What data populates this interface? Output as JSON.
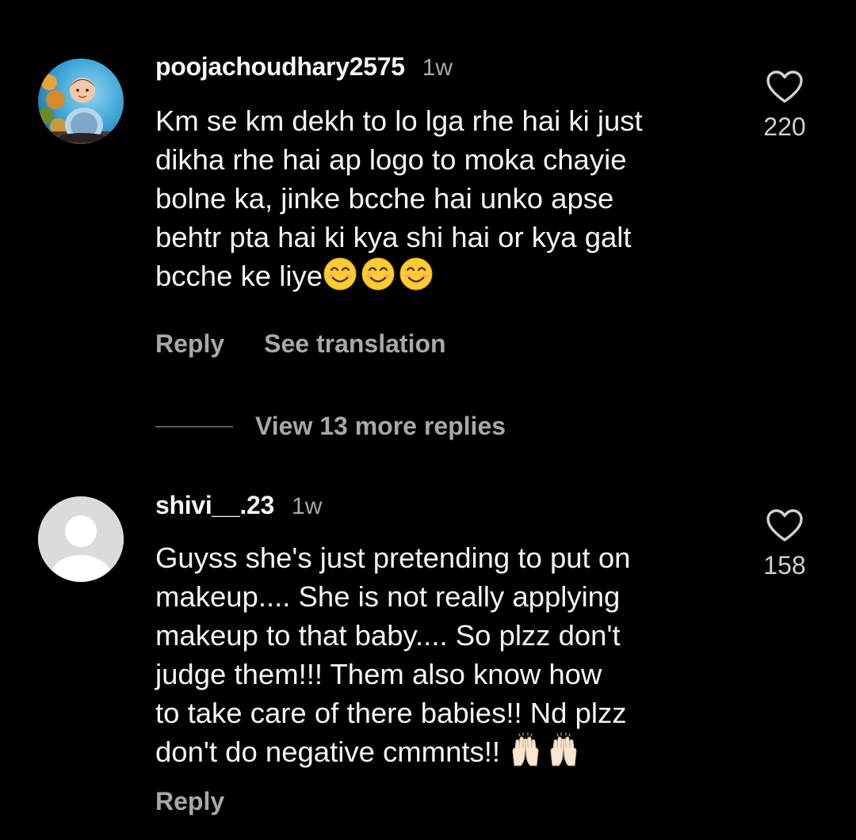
{
  "comments": [
    {
      "username": "poojachoudhary2575",
      "time": "1w",
      "text_lines": [
        "Km se km dekh to lo lga rhe hai ki just",
        "dikha rhe hai ap logo to moka chayie",
        "bolne ka, jinke bcche hai unko apse",
        "behtr pta hai ki kya shi hai or kya galt",
        "bcche ke liye"
      ],
      "trailing_emoji": [
        "smiling-face-emoji",
        "smiling-face-emoji",
        "smiling-face-emoji"
      ],
      "likes": "220",
      "reply_label": "Reply",
      "translate_label": "See translation",
      "view_replies_label": "View 13 more replies",
      "avatar": "profile-photo-child"
    },
    {
      "username": "shivi__.23",
      "time": "1w",
      "text_lines": [
        "Guyss she's just pretending to put on",
        "makeup.... She is not really applying",
        "makeup to that baby.... So plzz don't",
        "judge them!!! Them also know how",
        "to take care of there babies!! Nd plzz",
        "don't do negative cmmnts!! "
      ],
      "trailing_emoji": [
        "raising-hands-emoji",
        "raising-hands-emoji"
      ],
      "likes": "158",
      "reply_label": "Reply",
      "avatar": "default-avatar"
    }
  ],
  "colors": {
    "background": "#000000",
    "primary_text": "#f5f5f5",
    "secondary_text": "#a8a8a8",
    "default_avatar_bg": "#dbdbdb"
  },
  "icons": {
    "like": "heart-outline-icon"
  }
}
